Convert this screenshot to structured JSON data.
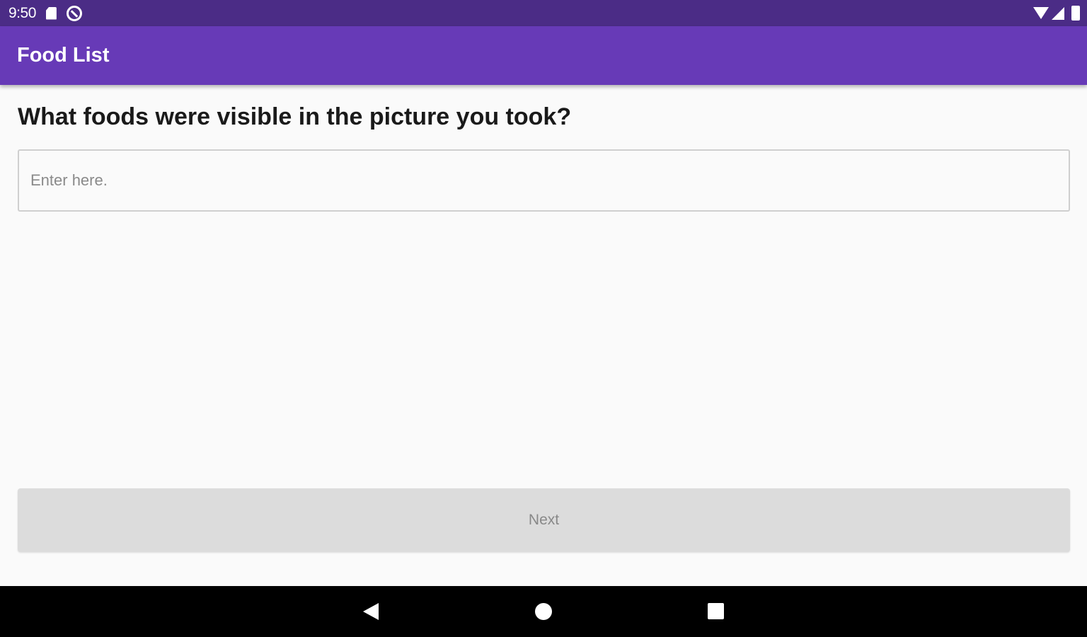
{
  "status_bar": {
    "time": "9:50",
    "icons": [
      "sd-card-icon",
      "do-not-disturb-icon",
      "wifi-icon",
      "cell-signal-icon",
      "battery-icon"
    ]
  },
  "app_bar": {
    "title": "Food List",
    "color": "#673ab7"
  },
  "main": {
    "question": "What foods were visible in the picture you took?",
    "input": {
      "value": "",
      "placeholder": "Enter here."
    },
    "next_button_label": "Next"
  },
  "nav_bar": {
    "icons": [
      "back-icon",
      "home-icon",
      "recent-apps-icon"
    ]
  }
}
